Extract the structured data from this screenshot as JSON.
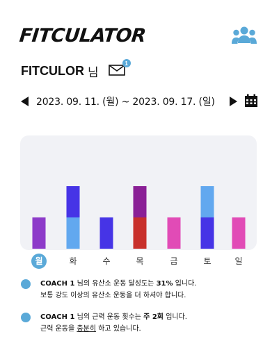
{
  "app": {
    "logo": "FITCULATOR",
    "group_icon": "group-icon"
  },
  "user": {
    "name": "FITCULOR",
    "suffix": "님",
    "mail_badge": "1"
  },
  "week": {
    "range": "2023. 09. 11. (월) ~ 2023. 09. 17. (일)"
  },
  "chart_data": {
    "type": "bar",
    "stacked": true,
    "categories": [
      "월",
      "화",
      "수",
      "목",
      "금",
      "토",
      "일"
    ],
    "selected_category": "월",
    "segment_colors": [
      [
        "#8d3bc9"
      ],
      [
        "#62a8ef",
        "#4634e6"
      ],
      [
        "#4634e6"
      ],
      [
        "#c8302b",
        "#8a2096"
      ],
      [
        "#e14bb6"
      ],
      [
        "#4634e6",
        "#62a8ef"
      ],
      [
        "#e14bb6"
      ]
    ],
    "segments": [
      [
        1
      ],
      [
        1,
        1
      ],
      [
        1
      ],
      [
        1,
        1
      ],
      [
        1
      ],
      [
        1,
        1
      ],
      [
        1
      ]
    ],
    "ylim": [
      0,
      3
    ]
  },
  "notes": [
    {
      "line1_a": "COACH 1",
      "line1_b": " 님의 유산소 운동 달성도는 ",
      "line1_c": "31%",
      "line1_d": " 입니다.",
      "line2": "보통 강도 이상의 유산소 운동을 더 하셔야 합니다."
    },
    {
      "line1_a": "COACH 1",
      "line1_b": " 님의 근력 운동 횟수는 ",
      "line1_c": "주 2회",
      "line1_d": " 입니다.",
      "line2_a": "근력 운동을 ",
      "line2_b": "충분히",
      "line2_c": " 하고 있습니다."
    }
  ]
}
